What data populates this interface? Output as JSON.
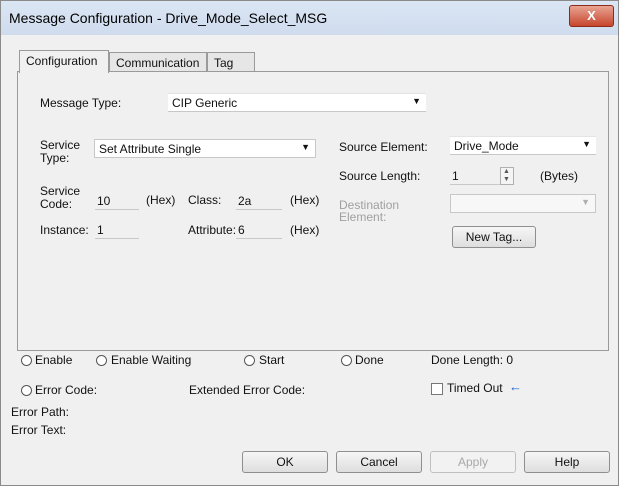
{
  "window": {
    "title": "Message Configuration - Drive_Mode_Select_MSG",
    "close_glyph": "X"
  },
  "tabs": [
    {
      "label": "Configuration",
      "active": true
    },
    {
      "label": "Communication",
      "active": false
    },
    {
      "label": "Tag",
      "active": false
    }
  ],
  "config": {
    "message_type_label": "Message Type:",
    "message_type_value": "CIP Generic",
    "service_type_label_1": "Service",
    "service_type_label_2": "Type:",
    "service_type_value": "Set Attribute Single",
    "service_code_label_1": "Service",
    "service_code_label_2": "Code:",
    "service_code_value": "10",
    "hex_label_1": "(Hex)",
    "class_label": "Class:",
    "class_value": "2a",
    "hex_label_2": "(Hex)",
    "instance_label": "Instance:",
    "instance_value": "1",
    "attribute_label": "Attribute:",
    "attribute_value": "6",
    "hex_label_3": "(Hex)",
    "source_element_label": "Source Element:",
    "source_element_value": "Drive_Mode",
    "source_length_label": "Source Length:",
    "source_length_value": "1",
    "bytes_label": "(Bytes)",
    "destination_label_1": "Destination",
    "destination_label_2": "Element:",
    "destination_value": "",
    "new_tag_button": "New Tag..."
  },
  "status": {
    "enable": "Enable",
    "enable_waiting": "Enable Waiting",
    "start": "Start",
    "done": "Done",
    "done_length": "Done Length: 0",
    "error_code": "Error Code:",
    "extended_error_code": "Extended Error Code:",
    "timed_out": "Timed Out",
    "error_path": "Error Path:",
    "error_text": "Error Text:"
  },
  "buttons": {
    "ok": "OK",
    "cancel": "Cancel",
    "apply": "Apply",
    "help": "Help"
  },
  "icons": {
    "dropdown": "chevron-down-icon",
    "close": "close-icon",
    "pointer": "left-arrow-icon"
  }
}
